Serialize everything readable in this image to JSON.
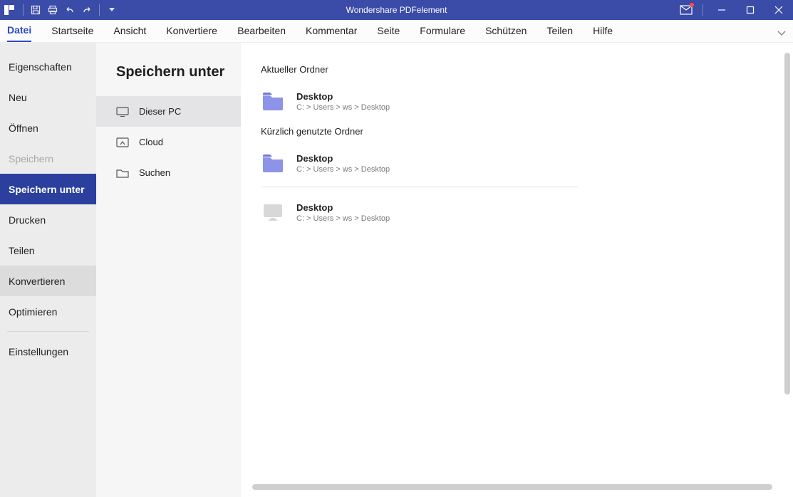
{
  "app_title": "Wondershare PDFelement",
  "ribbon_tabs": [
    {
      "label": "Datei",
      "active": true
    },
    {
      "label": "Startseite"
    },
    {
      "label": "Ansicht"
    },
    {
      "label": "Konvertieren"
    },
    {
      "label": "Bearbeiten"
    },
    {
      "label": "Kommentar"
    },
    {
      "label": "Seite"
    },
    {
      "label": "Formulare"
    },
    {
      "label": "Schützen"
    },
    {
      "label": "Teilen"
    },
    {
      "label": "Hilfe"
    }
  ],
  "file_menu": {
    "items": [
      {
        "label": "Eigenschaften"
      },
      {
        "label": "Neu"
      },
      {
        "label": "Öffnen"
      },
      {
        "label": "Speichern",
        "disabled": true
      },
      {
        "label": "Speichern unter",
        "selected": true
      },
      {
        "label": "Drucken"
      },
      {
        "label": "Teilen"
      },
      {
        "label": "Konvertieren",
        "hover": true
      },
      {
        "label": "Optimieren"
      }
    ],
    "settings_label": "Einstellungen"
  },
  "save_as": {
    "title": "Speichern unter",
    "sources": [
      {
        "label": "Dieser PC",
        "icon": "monitor",
        "selected": true
      },
      {
        "label": "Cloud",
        "icon": "cloud"
      },
      {
        "label": "Suchen",
        "icon": "folder"
      }
    ],
    "current_folder_header": "Aktueller Ordner",
    "recent_folder_header": "Kürzlich genutzte Ordner",
    "folders": [
      {
        "section": "current",
        "name": "Desktop",
        "path": "C: > Users > ws > Desktop",
        "type": "folder-purple"
      },
      {
        "section": "recent",
        "name": "Desktop",
        "path": "C: > Users > ws > Desktop",
        "type": "folder-purple"
      },
      {
        "section": "recent",
        "name": "Desktop",
        "path": "C: > Users > ws > Desktop",
        "type": "monitor-grey"
      }
    ]
  }
}
